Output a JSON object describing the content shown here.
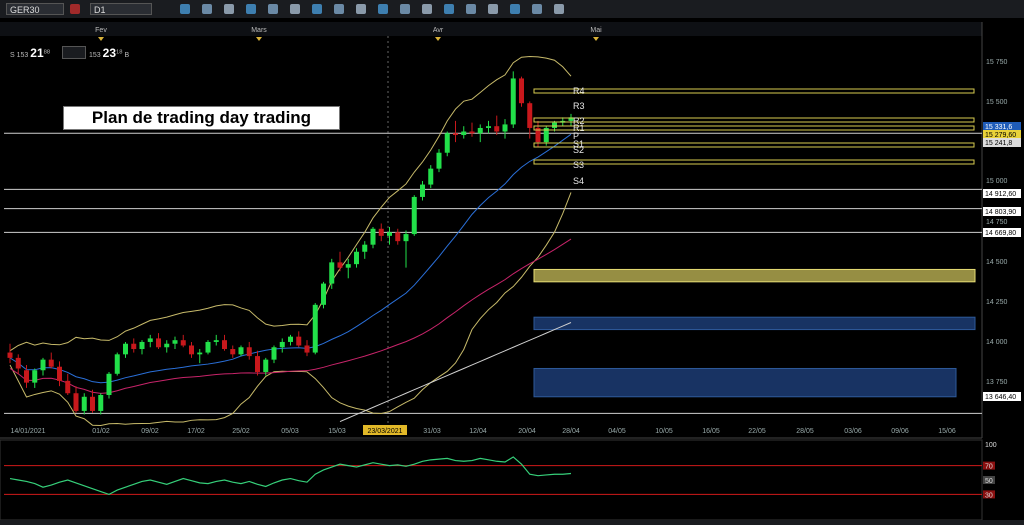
{
  "toolbar": {
    "symbol": "GER30",
    "timeframe": "D1",
    "icons": [
      "folder-icon",
      "save-icon",
      "crosshair-icon",
      "line-icon",
      "zoom-in-icon",
      "zoom-out-icon",
      "indicator-icon",
      "settings-icon",
      "text-icon",
      "refresh-icon",
      "globe-icon",
      "pencil-icon",
      "link-icon",
      "chart-icon",
      "grid-icon",
      "dot-icon",
      "menu-icon",
      "close-icon"
    ]
  },
  "quotes": {
    "bid": {
      "label": "S",
      "prefix": "153",
      "big": "21",
      "sup": "88"
    },
    "ask": {
      "label": "B",
      "prefix": "153",
      "big": "23",
      "sup": "18"
    }
  },
  "title": "Plan de trading day trading",
  "chart_data": {
    "type": "candlestick",
    "months": [
      "Fev",
      "Mars",
      "Avr",
      "Mai"
    ],
    "x_tick_labels": [
      "14/01/2021",
      "01/02",
      "09/02",
      "17/02",
      "25/02",
      "05/03",
      "15/03",
      "23/03/2021",
      "31/03",
      "12/04",
      "20/04",
      "28/04",
      "04/05",
      "10/05",
      "16/05",
      "22/05",
      "28/05",
      "03/06",
      "09/06",
      "15/06"
    ],
    "highlighted_tick": "23/03/2021",
    "y_tick_labels": [
      "15 750",
      "15 500",
      "15 250",
      "15 000",
      "14 750",
      "14 500",
      "14 250",
      "14 000",
      "13 750"
    ],
    "ylim": [
      13620,
      15780
    ],
    "price_tags": [
      "15 331,6",
      "15 279,60",
      "15 241,8",
      "14 912,60",
      "14 803,90",
      "14 669,80",
      "13 646,40"
    ],
    "pivot_labels": [
      "R4",
      "R3",
      "R2",
      "R1",
      "P",
      "S1",
      "S2",
      "S3",
      "S4"
    ],
    "horizontal_levels": [
      15230,
      14912.6,
      14803.9,
      14669.8,
      13646.4
    ],
    "pivot_levels": [
      15550,
      15340,
      15280,
      15240,
      15120
    ],
    "zones": [
      {
        "name": "resistance-zone",
        "low": 14390,
        "high": 14460,
        "color": "#c8be5a"
      },
      {
        "name": "support-zone-1",
        "low": 14120,
        "high": 14190,
        "color": "#1c3c74"
      },
      {
        "name": "support-zone-2",
        "low": 13740,
        "high": 13900,
        "color": "#1c3c74"
      }
    ],
    "candles": [
      [
        13990,
        14040,
        13930,
        13960
      ],
      [
        13960,
        13980,
        13870,
        13900
      ],
      [
        13890,
        13920,
        13790,
        13820
      ],
      [
        13820,
        13900,
        13790,
        13890
      ],
      [
        13890,
        13960,
        13860,
        13950
      ],
      [
        13950,
        13990,
        13900,
        13910
      ],
      [
        13910,
        13940,
        13800,
        13830
      ],
      [
        13830,
        13870,
        13750,
        13760
      ],
      [
        13760,
        13800,
        13650,
        13660
      ],
      [
        13660,
        13760,
        13640,
        13740
      ],
      [
        13740,
        13780,
        13650,
        13660
      ],
      [
        13660,
        13760,
        13640,
        13750
      ],
      [
        13750,
        13880,
        13730,
        13870
      ],
      [
        13870,
        13990,
        13860,
        13980
      ],
      [
        13980,
        14050,
        13960,
        14040
      ],
      [
        14040,
        14070,
        13990,
        14010
      ],
      [
        14010,
        14060,
        13980,
        14050
      ],
      [
        14050,
        14090,
        14020,
        14070
      ],
      [
        14070,
        14100,
        14010,
        14020
      ],
      [
        14020,
        14060,
        13990,
        14040
      ],
      [
        14040,
        14080,
        14010,
        14060
      ],
      [
        14060,
        14090,
        14020,
        14030
      ],
      [
        14030,
        14050,
        13960,
        13980
      ],
      [
        13980,
        14010,
        13930,
        13990
      ],
      [
        13990,
        14060,
        13980,
        14050
      ],
      [
        14050,
        14090,
        14030,
        14060
      ],
      [
        14060,
        14090,
        14000,
        14010
      ],
      [
        14010,
        14030,
        13960,
        13980
      ],
      [
        13980,
        14030,
        13970,
        14020
      ],
      [
        14020,
        14050,
        13950,
        13970
      ],
      [
        13970,
        14000,
        13860,
        13880
      ],
      [
        13880,
        13960,
        13860,
        13950
      ],
      [
        13950,
        14030,
        13930,
        14020
      ],
      [
        14020,
        14070,
        13990,
        14050
      ],
      [
        14050,
        14090,
        14030,
        14080
      ],
      [
        14080,
        14110,
        14020,
        14030
      ],
      [
        14030,
        14060,
        13970,
        13990
      ],
      [
        13990,
        14270,
        13980,
        14260
      ],
      [
        14260,
        14390,
        14240,
        14380
      ],
      [
        14380,
        14520,
        14350,
        14500
      ],
      [
        14500,
        14560,
        14450,
        14470
      ],
      [
        14470,
        14520,
        14410,
        14490
      ],
      [
        14490,
        14580,
        14470,
        14560
      ],
      [
        14560,
        14620,
        14520,
        14600
      ],
      [
        14600,
        14700,
        14580,
        14690
      ],
      [
        14690,
        14720,
        14620,
        14650
      ],
      [
        14650,
        14700,
        14600,
        14670
      ],
      [
        14670,
        14690,
        14600,
        14620
      ],
      [
        14620,
        14680,
        14470,
        14660
      ],
      [
        14660,
        14880,
        14650,
        14870
      ],
      [
        14870,
        14960,
        14850,
        14940
      ],
      [
        14940,
        15050,
        14920,
        15030
      ],
      [
        15030,
        15140,
        15010,
        15120
      ],
      [
        15120,
        15240,
        15100,
        15230
      ],
      [
        15230,
        15300,
        15180,
        15220
      ],
      [
        15220,
        15270,
        15200,
        15240
      ],
      [
        15240,
        15290,
        15210,
        15230
      ],
      [
        15230,
        15280,
        15180,
        15260
      ],
      [
        15260,
        15300,
        15230,
        15270
      ],
      [
        15270,
        15330,
        15220,
        15240
      ],
      [
        15240,
        15310,
        15200,
        15280
      ],
      [
        15280,
        15580,
        15260,
        15540
      ],
      [
        15540,
        15550,
        15380,
        15400
      ],
      [
        15400,
        15410,
        15200,
        15260
      ],
      [
        15260,
        15300,
        15150,
        15180
      ],
      [
        15180,
        15270,
        15160,
        15260
      ],
      [
        15260,
        15300,
        15240,
        15290
      ],
      [
        15290,
        15320,
        15270,
        15300
      ],
      [
        15300,
        15340,
        15270,
        15320
      ]
    ],
    "lower_indicator": {
      "type": "line",
      "levels": [
        100,
        70,
        50,
        30
      ],
      "level_labels": [
        "100",
        "70",
        "50",
        "30"
      ],
      "values": [
        52,
        50,
        48,
        45,
        40,
        43,
        47,
        50,
        46,
        42,
        38,
        34,
        30,
        36,
        40,
        44,
        48,
        50,
        47,
        44,
        48,
        52,
        49,
        46,
        45,
        48,
        50,
        47,
        45,
        48,
        44,
        41,
        46,
        50,
        52,
        49,
        47,
        58,
        64,
        68,
        72,
        70,
        68,
        71,
        74,
        72,
        70,
        71,
        69,
        72,
        76,
        78,
        79,
        80,
        77,
        76,
        77,
        80,
        78,
        76,
        75,
        82,
        72,
        58,
        56,
        57,
        58,
        58,
        59
      ]
    }
  },
  "colors": {
    "background": "#000000",
    "up_candle": "#22e04a",
    "down_candle": "#c8181c",
    "bollinger": "#c7ba6a",
    "ma_fast": "#2a6fd8",
    "ma_slow": "#c8246a",
    "ma_long": "#d0d0d0",
    "pivot": "#d8cc50",
    "level": "#cfcfcf",
    "indicator_line": "#36d07a",
    "indicator_level": "#d01a1a",
    "tag_yellow": "#e8d23a",
    "tag_blue": "#1f5cb8"
  }
}
